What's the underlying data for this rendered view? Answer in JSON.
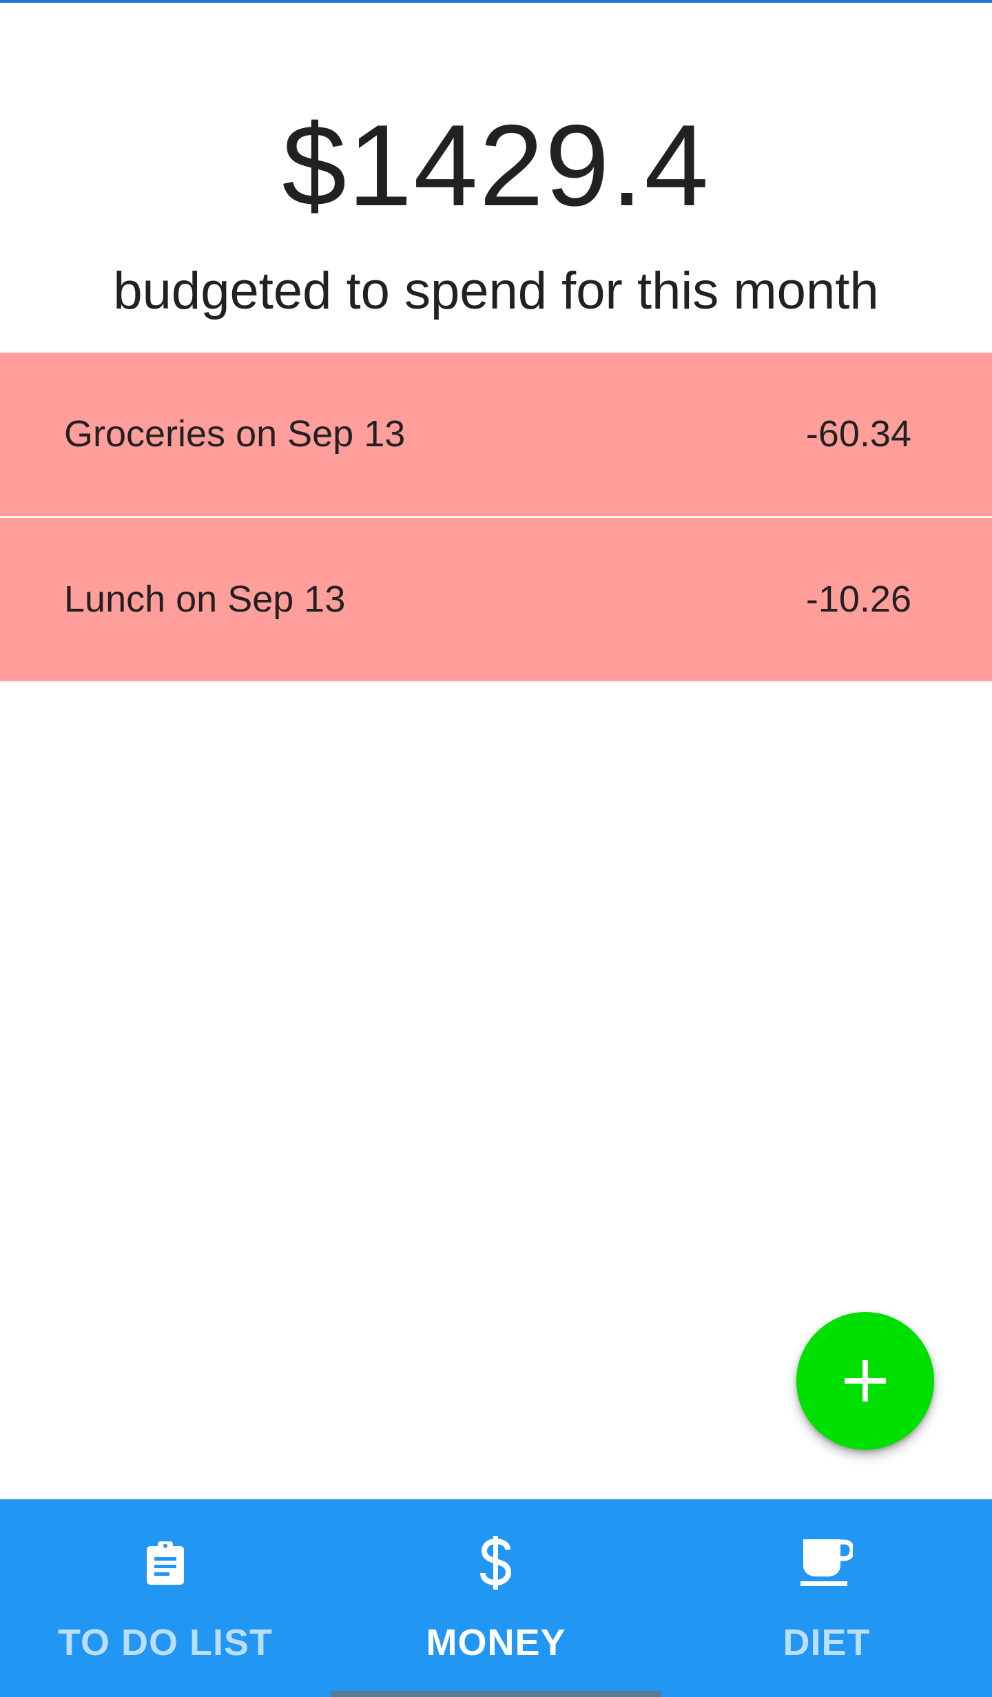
{
  "budget": {
    "amount": "$1429.4",
    "caption": "budgeted to spend for this month"
  },
  "expenses": [
    {
      "label": "Groceries on Sep 13",
      "amount": "-60.34"
    },
    {
      "label": "Lunch on Sep 13",
      "amount": "-10.26"
    }
  ],
  "fab": {
    "icon": "plus-icon"
  },
  "bottom_nav": {
    "tabs": [
      {
        "label": "TO DO LIST",
        "icon": "clipboard-icon",
        "active": false
      },
      {
        "label": "MONEY",
        "icon": "dollar-icon",
        "active": true
      },
      {
        "label": "DIET",
        "icon": "coffee-cup-icon",
        "active": false
      }
    ]
  },
  "colors": {
    "accent": "#2196F3",
    "status_bar": "#1976D2",
    "expense_row": "#FF9E9B",
    "fab": "#00E000",
    "inactive_tab_text": "#BBDEFB"
  }
}
